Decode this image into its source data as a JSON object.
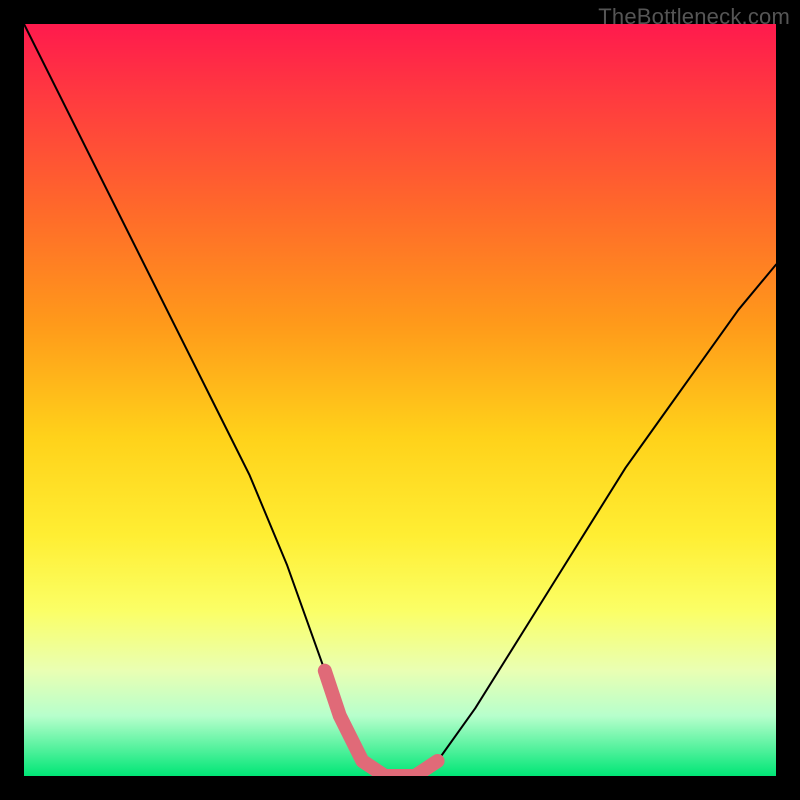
{
  "watermark": "TheBottleneck.com",
  "colors": {
    "frame": "#000000",
    "gradient_top": "#ff1a4d",
    "gradient_bottom": "#00e676",
    "curve_main": "#000000",
    "highlight": "#e06a78"
  },
  "chart_data": {
    "type": "line",
    "title": "",
    "xlabel": "",
    "ylabel": "",
    "xlim": [
      0,
      100
    ],
    "ylim": [
      0,
      100
    ],
    "grid": false,
    "legend": false,
    "annotations": [
      "TheBottleneck.com"
    ],
    "series": [
      {
        "name": "bottleneck-curve",
        "x": [
          0,
          5,
          10,
          15,
          20,
          25,
          30,
          35,
          40,
          42,
          45,
          48,
          50,
          52,
          55,
          60,
          65,
          70,
          75,
          80,
          85,
          90,
          95,
          100
        ],
        "values": [
          100,
          90,
          80,
          70,
          60,
          50,
          40,
          28,
          14,
          8,
          2,
          0,
          0,
          0,
          2,
          9,
          17,
          25,
          33,
          41,
          48,
          55,
          62,
          68
        ]
      }
    ],
    "highlight_segment": {
      "x": [
        40,
        42,
        45,
        48,
        50,
        52,
        55
      ],
      "values": [
        14,
        8,
        2,
        0,
        0,
        0,
        2
      ]
    }
  }
}
